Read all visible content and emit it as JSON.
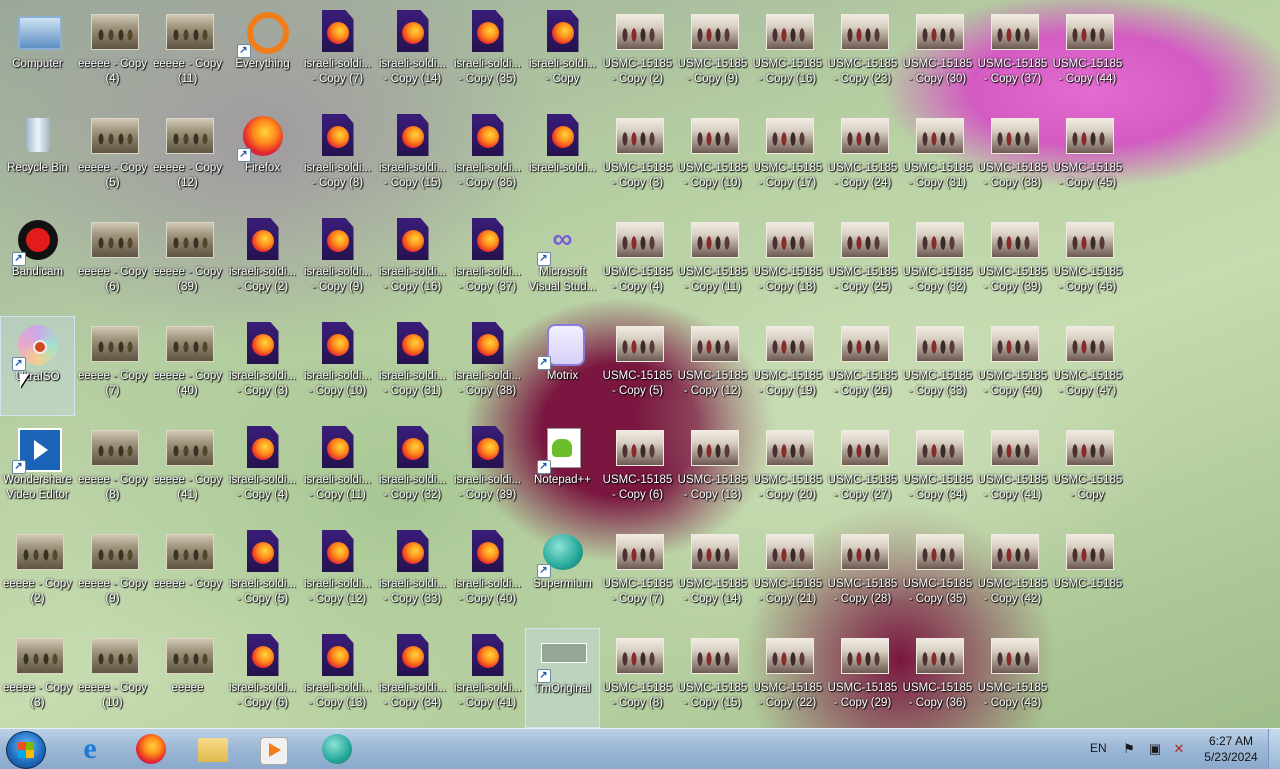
{
  "desktop": {
    "col0": [
      {
        "label": "Computer",
        "icon": "computer-icon"
      },
      {
        "label": "Recycle Bin",
        "icon": "recycle-bin-icon"
      },
      {
        "label": "Bandicam",
        "icon": "bandicam-icon"
      },
      {
        "label": "UltraISO",
        "icon": "ultraiso-icon"
      },
      {
        "label": "Wondershare\nVideo Editor",
        "icon": "video-editor-icon"
      },
      {
        "label": "eeeee - Copy\n(2)",
        "icon": "image-thumbnail-icon"
      },
      {
        "label": "eeeee - Copy\n(3)",
        "icon": "image-thumbnail-icon"
      }
    ],
    "col1": [
      {
        "label": "eeeee - Copy\n(4)"
      },
      {
        "label": "eeeee - Copy\n(5)"
      },
      {
        "label": "eeeee - Copy\n(6)"
      },
      {
        "label": "eeeee - Copy\n(7)"
      },
      {
        "label": "eeeee - Copy\n(8)"
      },
      {
        "label": "eeeee - Copy\n(9)"
      },
      {
        "label": "eeeee - Copy\n(10)"
      }
    ],
    "col2": [
      {
        "label": "eeeee - Copy\n(11)"
      },
      {
        "label": "eeeee - Copy\n(12)"
      },
      {
        "label": "eeeee - Copy\n(39)"
      },
      {
        "label": "eeeee - Copy\n(40)"
      },
      {
        "label": "eeeee - Copy\n(41)"
      },
      {
        "label": "eeeee - Copy"
      },
      {
        "label": "eeeee"
      }
    ],
    "col3": [
      {
        "label": "Everything",
        "icon": "everything-icon"
      },
      {
        "label": "Firefox",
        "icon": "firefox-icon"
      },
      {
        "label": "israeli-soldi...\n- Copy (2)"
      },
      {
        "label": "israeli-soldi...\n- Copy (3)"
      },
      {
        "label": "israeli-soldi...\n- Copy (4)"
      },
      {
        "label": "israeli-soldi...\n- Copy (5)"
      },
      {
        "label": "israeli-soldi...\n- Copy (6)"
      }
    ],
    "col4": [
      {
        "label": "israeli-soldi...\n- Copy (7)"
      },
      {
        "label": "israeli-soldi...\n- Copy (8)"
      },
      {
        "label": "israeli-soldi...\n- Copy (9)"
      },
      {
        "label": "israeli-soldi...\n- Copy (10)"
      },
      {
        "label": "israeli-soldi...\n- Copy (11)"
      },
      {
        "label": "israeli-soldi...\n- Copy (12)"
      },
      {
        "label": "israeli-soldi...\n- Copy (13)"
      }
    ],
    "col5": [
      {
        "label": "israeli-soldi...\n- Copy (14)"
      },
      {
        "label": "israeli-soldi...\n- Copy (15)"
      },
      {
        "label": "israeli-soldi...\n- Copy (16)"
      },
      {
        "label": "israeli-soldi...\n- Copy (31)"
      },
      {
        "label": "israeli-soldi...\n- Copy (32)"
      },
      {
        "label": "israeli-soldi...\n- Copy (33)"
      },
      {
        "label": "israeli-soldi...\n- Copy (34)"
      }
    ],
    "col6": [
      {
        "label": "israeli-soldi...\n- Copy (35)"
      },
      {
        "label": "israeli-soldi...\n- Copy (36)"
      },
      {
        "label": "israeli-soldi...\n- Copy (37)"
      },
      {
        "label": "israeli-soldi...\n- Copy (38)"
      },
      {
        "label": "israeli-soldi...\n- Copy (39)"
      },
      {
        "label": "israeli-soldi...\n- Copy (40)"
      },
      {
        "label": "israeli-soldi...\n- Copy (41)"
      }
    ],
    "col7": [
      {
        "label": "israeli-soldi...\n- Copy",
        "icon": "firefox-doc-icon"
      },
      {
        "label": "israeli-soldi...",
        "icon": "firefox-doc-icon"
      },
      {
        "label": "Microsoft\nVisual Stud...",
        "icon": "visual-studio-icon"
      },
      {
        "label": "Motrix",
        "icon": "motrix-icon"
      },
      {
        "label": "Notepad++",
        "icon": "notepad-plus-plus-icon"
      },
      {
        "label": "Supermium",
        "icon": "supermium-icon"
      },
      {
        "label": "TmOriginal",
        "icon": "tmoriginal-icon"
      }
    ],
    "col8": [
      {
        "label": "USMC-15185\n- Copy (2)"
      },
      {
        "label": "USMC-15185\n- Copy (3)"
      },
      {
        "label": "USMC-15185\n- Copy (4)"
      },
      {
        "label": "USMC-15185\n- Copy (5)"
      },
      {
        "label": "USMC-15185\n- Copy (6)"
      },
      {
        "label": "USMC-15185\n- Copy (7)"
      },
      {
        "label": "USMC-15185\n- Copy (8)"
      }
    ],
    "col9": [
      {
        "label": "USMC-15185\n- Copy (9)"
      },
      {
        "label": "USMC-15185\n- Copy (10)"
      },
      {
        "label": "USMC-15185\n- Copy (11)"
      },
      {
        "label": "USMC-15185\n- Copy (12)"
      },
      {
        "label": "USMC-15185\n- Copy (13)"
      },
      {
        "label": "USMC-15185\n- Copy (14)"
      },
      {
        "label": "USMC-15185\n- Copy (15)"
      }
    ],
    "col10": [
      {
        "label": "USMC-15185\n- Copy (16)"
      },
      {
        "label": "USMC-15185\n- Copy (17)"
      },
      {
        "label": "USMC-15185\n- Copy (18)"
      },
      {
        "label": "USMC-15185\n- Copy (19)"
      },
      {
        "label": "USMC-15185\n- Copy (20)"
      },
      {
        "label": "USMC-15185\n- Copy (21)"
      },
      {
        "label": "USMC-15185\n- Copy (22)"
      }
    ],
    "col11": [
      {
        "label": "USMC-15185\n- Copy (23)"
      },
      {
        "label": "USMC-15185\n- Copy (24)"
      },
      {
        "label": "USMC-15185\n- Copy (25)"
      },
      {
        "label": "USMC-15185\n- Copy (26)"
      },
      {
        "label": "USMC-15185\n- Copy (27)"
      },
      {
        "label": "USMC-15185\n- Copy (28)"
      },
      {
        "label": "USMC-15185\n- Copy (29)"
      }
    ],
    "col12": [
      {
        "label": "USMC-15185\n- Copy (30)"
      },
      {
        "label": "USMC-15185\n- Copy (31)"
      },
      {
        "label": "USMC-15185\n- Copy (32)"
      },
      {
        "label": "USMC-15185\n- Copy (33)"
      },
      {
        "label": "USMC-15185\n- Copy (34)"
      },
      {
        "label": "USMC-15185\n- Copy (35)"
      },
      {
        "label": "USMC-15185\n- Copy (36)"
      }
    ],
    "col13": [
      {
        "label": "USMC-15185\n- Copy (37)"
      },
      {
        "label": "USMC-15185\n- Copy (38)"
      },
      {
        "label": "USMC-15185\n- Copy (39)"
      },
      {
        "label": "USMC-15185\n- Copy (40)"
      },
      {
        "label": "USMC-15185\n- Copy (41)"
      },
      {
        "label": "USMC-15185\n- Copy (42)"
      },
      {
        "label": "USMC-15185\n- Copy (43)"
      }
    ],
    "col14": [
      {
        "label": "USMC-15185\n- Copy (44)"
      },
      {
        "label": "USMC-15185\n- Copy (45)"
      },
      {
        "label": "USMC-15185\n- Copy (46)"
      },
      {
        "label": "USMC-15185\n- Copy (47)"
      },
      {
        "label": "USMC-15185\n- Copy"
      },
      {
        "label": "USMC-15185"
      }
    ]
  },
  "taskbar": {
    "pinned": [
      "start-orb-icon",
      "internet-explorer-icon",
      "firefox-icon",
      "file-explorer-icon",
      "media-player-icon",
      "supermium-icon"
    ],
    "language": "EN",
    "time": "6:27 AM",
    "date": "5/23/2024"
  },
  "colors": {
    "taskbar": "#9db8d6",
    "selection": "#c8dcf0"
  }
}
